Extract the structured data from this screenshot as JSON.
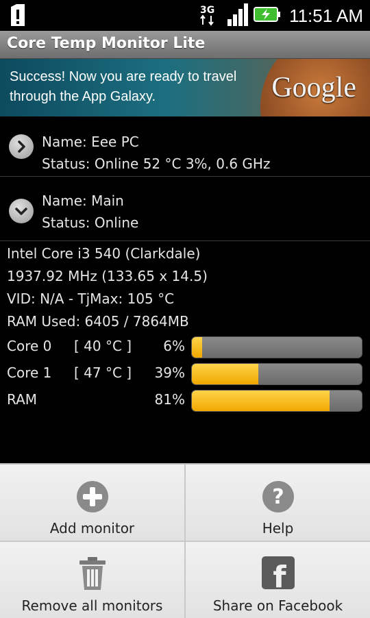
{
  "status_bar": {
    "network": "3G",
    "time": "11:51 AM"
  },
  "app": {
    "title": "Core Temp Monitor Lite"
  },
  "ad": {
    "text": "Success! Now you are ready to travel through the App Galaxy.",
    "logo": "Google"
  },
  "monitors": [
    {
      "name": "Name: Eee PC",
      "status": "Status: Online  52 °C 3%, 0.6 GHz",
      "expand_icon": "chevron-right-icon"
    },
    {
      "name": "Name: Main",
      "status": "Status: Online",
      "expand_icon": "chevron-down-icon"
    }
  ],
  "details": {
    "cpu": "Intel Core i3 540 (Clarkdale)",
    "freq": "1937.92 MHz (133.65 x 14.5)",
    "vid": "VID: N/A - TjMax: 105 °C",
    "ram": "RAM Used: 6405 / 7864MB",
    "bars": [
      {
        "label": "Core 0",
        "temp": "[ 40 °C ]",
        "percent_text": "6%",
        "fill": 0.06
      },
      {
        "label": "Core 1",
        "temp": "[ 47 °C ]",
        "percent_text": "39%",
        "fill": 0.39
      },
      {
        "label": "RAM",
        "temp": "",
        "percent_text": "81%",
        "fill": 0.81
      }
    ]
  },
  "menu": {
    "add": "Add monitor",
    "help": "Help",
    "remove": "Remove all monitors",
    "share": "Share on Facebook"
  },
  "colors": {
    "bar_fill": "#f5b800",
    "bar_track": "#777777"
  }
}
